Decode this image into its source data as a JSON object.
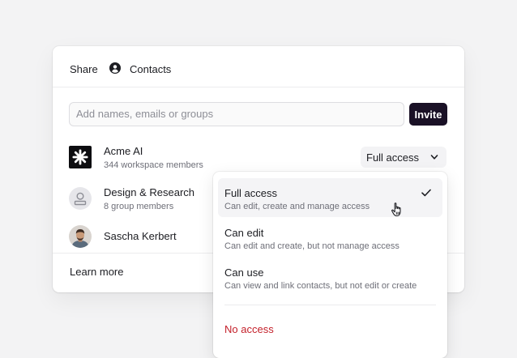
{
  "share_dialog": {
    "title": "Share",
    "target": {
      "icon": "person-circle-icon",
      "label": "Contacts"
    },
    "invite_input": {
      "placeholder": "Add names, emails or groups",
      "value": ""
    },
    "invite_button": "Invite",
    "members": [
      {
        "name": "Acme AI",
        "subtitle": "344 workspace members",
        "avatar": "acme-logo"
      },
      {
        "name": "Design & Research",
        "subtitle": "8 group members",
        "avatar": "group-placeholder"
      },
      {
        "name": "Sascha Kerbert",
        "subtitle": "",
        "avatar": "person-photo"
      }
    ],
    "access_select": {
      "label": "Full access",
      "icon": "chevron-down-icon"
    },
    "footer": {
      "learn_more": "Learn more"
    }
  },
  "access_menu": {
    "options": [
      {
        "title": "Full access",
        "description": "Can edit, create and manage access",
        "selected": true
      },
      {
        "title": "Can edit",
        "description": "Can edit and create, but not manage access",
        "selected": false
      },
      {
        "title": "Can use",
        "description": "Can view and link contacts, but not edit or create",
        "selected": false
      }
    ],
    "no_access": "No access"
  },
  "colors": {
    "background": "#f3f3f4",
    "invite_button": "#1a1126",
    "danger": "#c4212b"
  }
}
